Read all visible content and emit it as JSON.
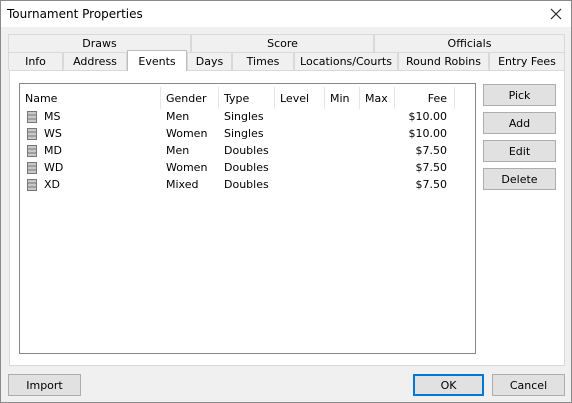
{
  "window": {
    "title": "Tournament Properties"
  },
  "tabs_top": [
    {
      "label": "Draws"
    },
    {
      "label": "Score"
    },
    {
      "label": "Officials"
    }
  ],
  "tabs_bottom": [
    {
      "label": "Info"
    },
    {
      "label": "Address"
    },
    {
      "label": "Events"
    },
    {
      "label": "Days"
    },
    {
      "label": "Times"
    },
    {
      "label": "Locations/Courts"
    },
    {
      "label": "Round Robins"
    },
    {
      "label": "Entry Fees"
    }
  ],
  "active_tab": "Events",
  "events_table": {
    "columns": [
      "Name",
      "Gender",
      "Type",
      "Level",
      "Min",
      "Max",
      "Fee"
    ],
    "rows": [
      {
        "name": "MS",
        "gender": "Men",
        "type": "Singles",
        "level": "",
        "min": "",
        "max": "",
        "fee": "$10.00"
      },
      {
        "name": "WS",
        "gender": "Women",
        "type": "Singles",
        "level": "",
        "min": "",
        "max": "",
        "fee": "$10.00"
      },
      {
        "name": "MD",
        "gender": "Men",
        "type": "Doubles",
        "level": "",
        "min": "",
        "max": "",
        "fee": "$7.50"
      },
      {
        "name": "WD",
        "gender": "Women",
        "type": "Doubles",
        "level": "",
        "min": "",
        "max": "",
        "fee": "$7.50"
      },
      {
        "name": "XD",
        "gender": "Mixed",
        "type": "Doubles",
        "level": "",
        "min": "",
        "max": "",
        "fee": "$7.50"
      }
    ]
  },
  "side_buttons": {
    "pick": "Pick",
    "add": "Add",
    "edit": "Edit",
    "delete": "Delete"
  },
  "footer": {
    "import": "Import",
    "ok": "OK",
    "cancel": "Cancel"
  },
  "colors": {
    "accent": "#0078d7",
    "panel_bg": "#f0f0f0",
    "list_border": "#828790"
  },
  "icons": {
    "close": "close-icon",
    "row_icon": "database-icon"
  }
}
